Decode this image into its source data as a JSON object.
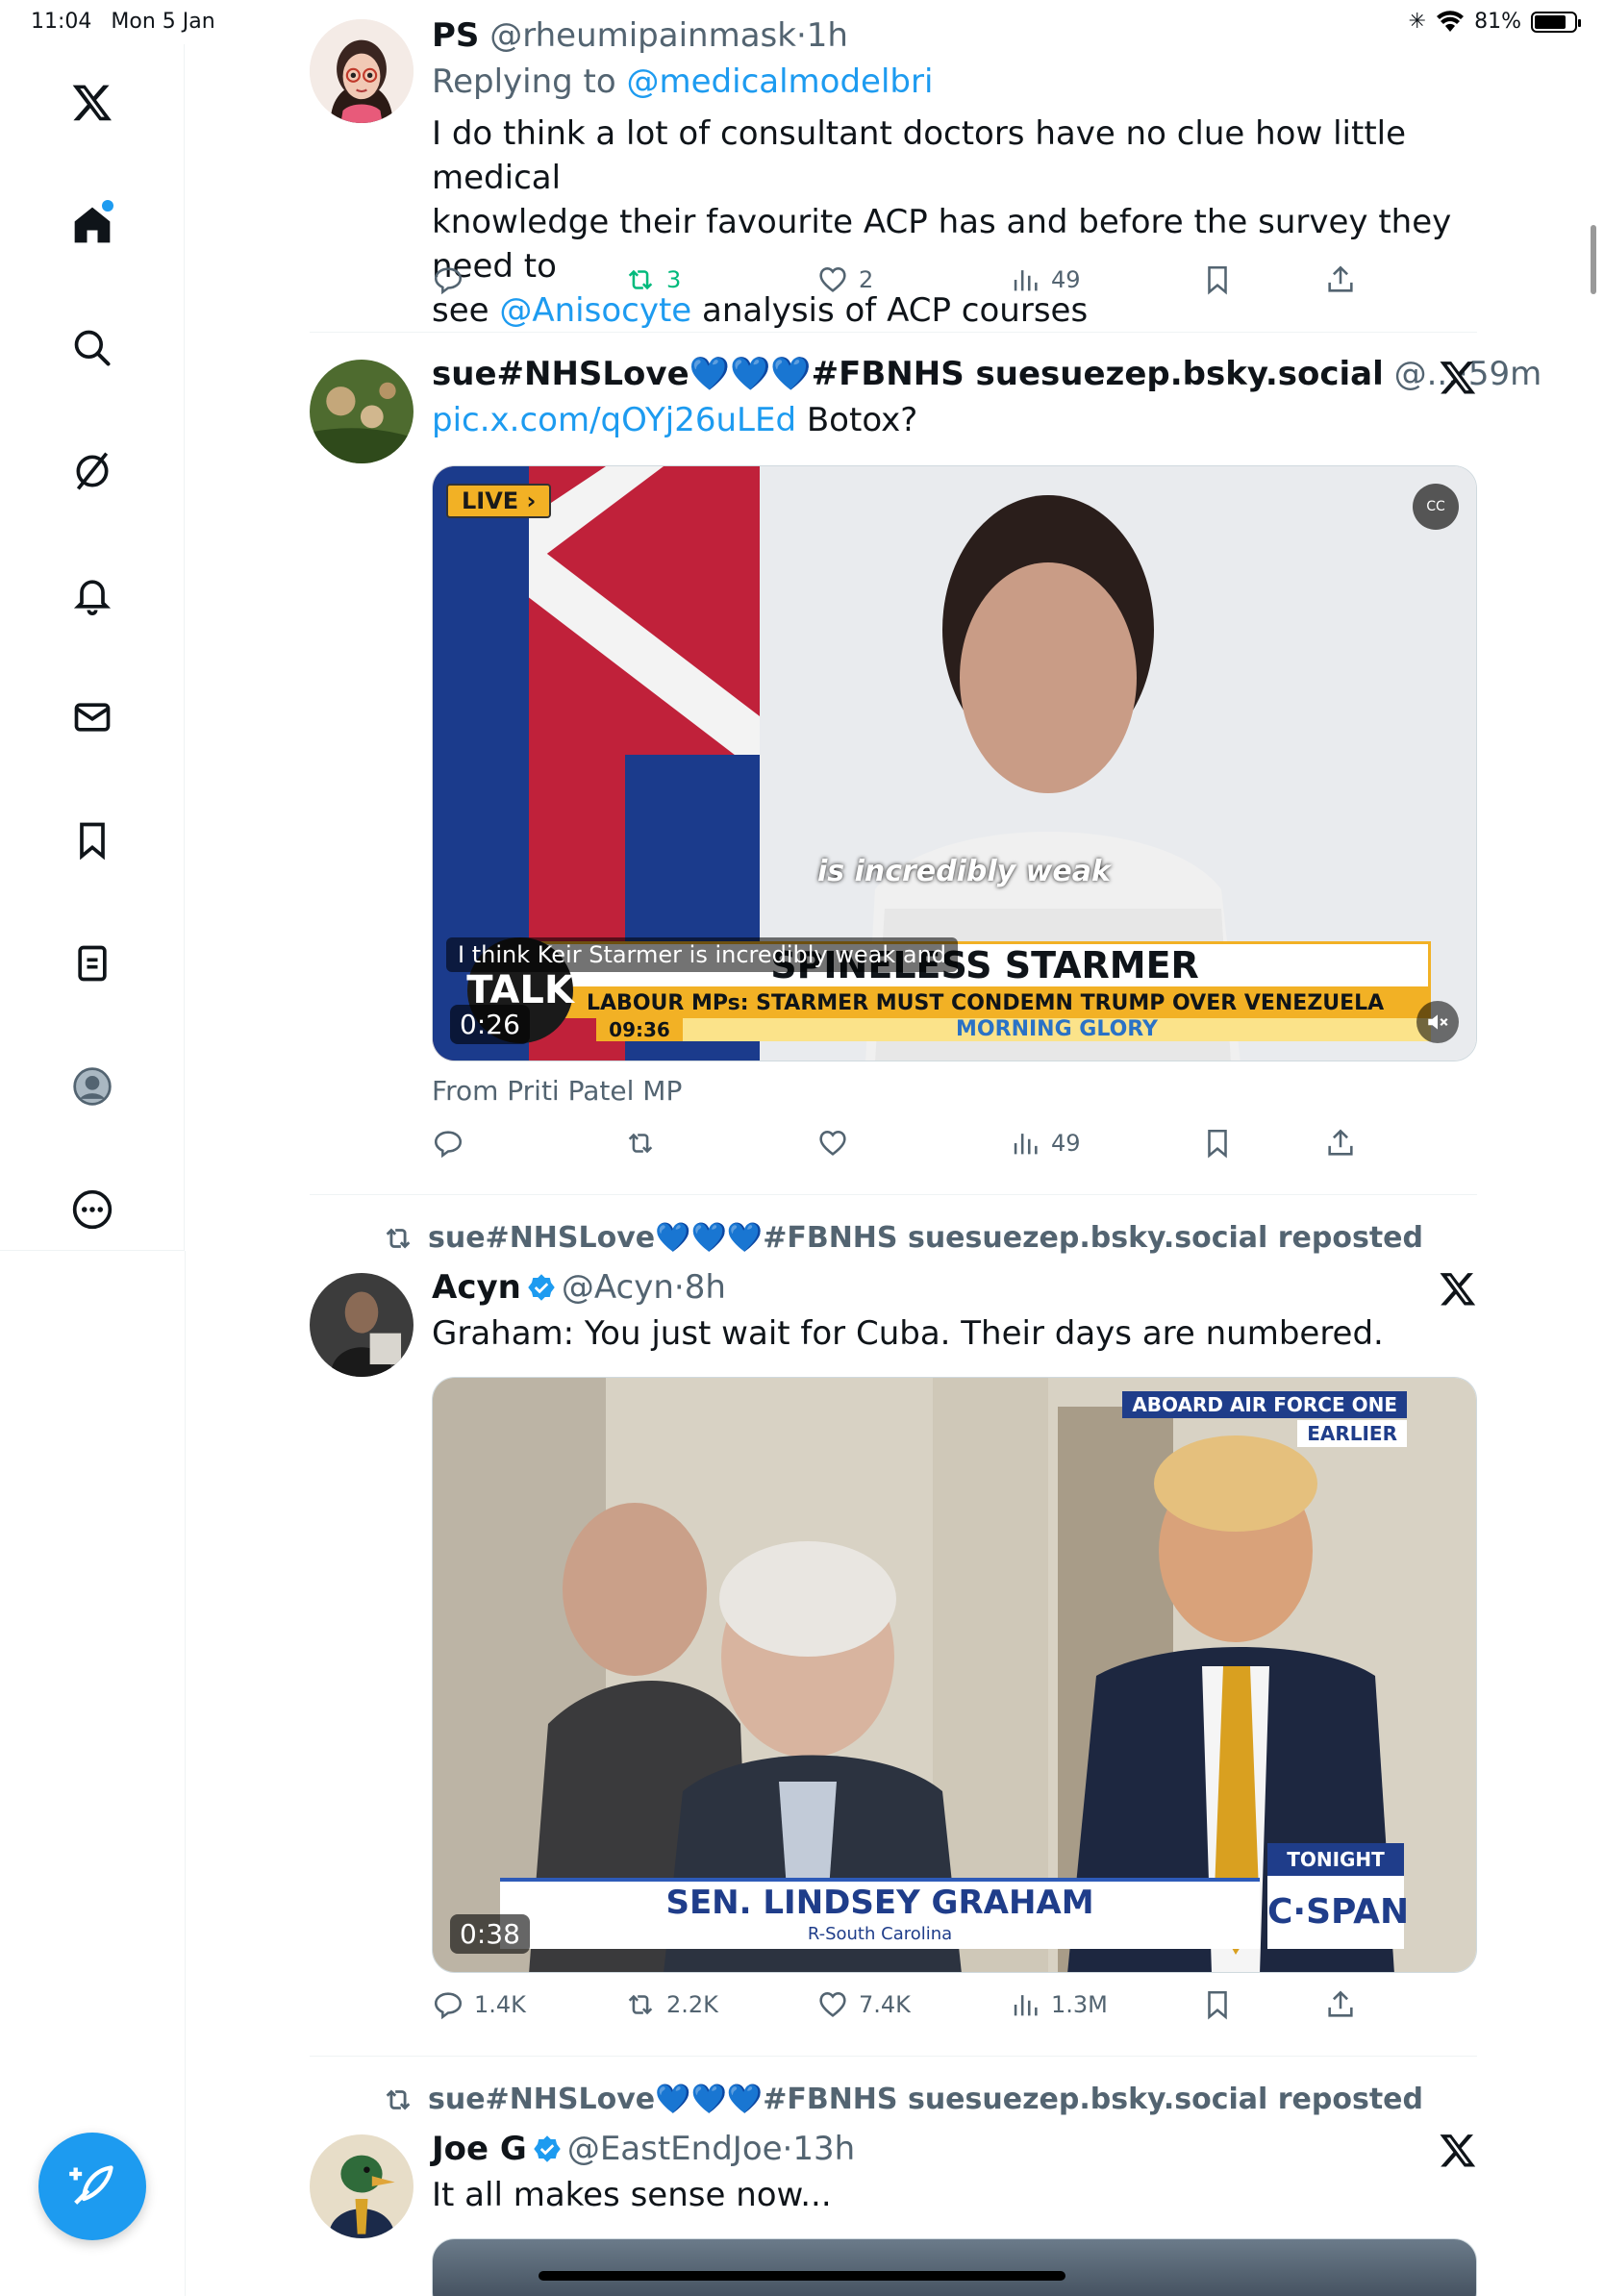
{
  "status": {
    "time": "11:04",
    "date": "Mon 5 Jan",
    "battery": "81%",
    "battery_level": 0.81
  },
  "sidebar": {
    "items": [
      {
        "name": "x-logo"
      },
      {
        "name": "home"
      },
      {
        "name": "explore"
      },
      {
        "name": "grok"
      },
      {
        "name": "notifications"
      },
      {
        "name": "messages"
      },
      {
        "name": "bookmarks"
      },
      {
        "name": "lists"
      },
      {
        "name": "profile"
      },
      {
        "name": "more"
      }
    ]
  },
  "tweets": [
    {
      "display_name": "PS",
      "handle": "@rheumipainmask",
      "time": "1h",
      "replying_prefix": "Replying to",
      "replying_to": "@medicalmodelbri",
      "text_line1": "I do think a lot of consultant doctors have no clue how little medical",
      "text_line2": "knowledge their favourite ACP has and before the survey they need to",
      "text_line3_pre": "see",
      "text_line3_link": "@Anisocyte",
      "text_line3_post": "analysis of ACP courses",
      "replies": "",
      "reposts": "3",
      "likes": "2",
      "views": "49"
    },
    {
      "display_name": "sue#NHSLove",
      "name_hearts": "💙💙💙",
      "display_name_tail": "#FBNHS suesuezep.bsky.social",
      "handle": "@...",
      "time": "59m",
      "link": "pic.x.com/qOYj26uLEd",
      "text": "Botox?",
      "video": {
        "live_badge": "LIVE",
        "caption_overlay": "is incredibly weak",
        "subtitle": "I think Keir Starmer is incredibly weak and",
        "headline": "SPINELESS STARMER",
        "subheadline": "LABOUR MPs: STARMER MUST CONDEMN TRUMP OVER VENEZUELA",
        "brand": "TALK",
        "clock": "09:36",
        "show": "MORNING GLORY",
        "cc": "CC",
        "duration": "0:26"
      },
      "source": "From Priti Patel MP",
      "replies": "",
      "reposts": "",
      "likes": "",
      "views": "49"
    },
    {
      "reposted_by": "sue#NHSLove💙💙💙#FBNHS suesuezep.bsky.social reposted",
      "display_name": "Acyn",
      "handle": "@Acyn",
      "time": "8h",
      "text": "Graham: You just wait for Cuba. Their days are numbered.",
      "video": {
        "banner1": "ABOARD AIR FORCE ONE",
        "banner2": "EARLIER",
        "lower_third": "SEN. LINDSEY GRAHAM",
        "lower_third_sub": "R-South Carolina",
        "tonight": "TONIGHT",
        "network": "C·SPAN",
        "duration": "0:38"
      },
      "replies": "1.4K",
      "reposts": "2.2K",
      "likes": "7.4K",
      "views": "1.3M"
    },
    {
      "reposted_by": "sue#NHSLove💙💙💙#FBNHS suesuezep.bsky.social reposted",
      "display_name": "Joe G",
      "handle": "@EastEndJoe",
      "time": "13h",
      "text": "It all makes sense now..."
    }
  ]
}
